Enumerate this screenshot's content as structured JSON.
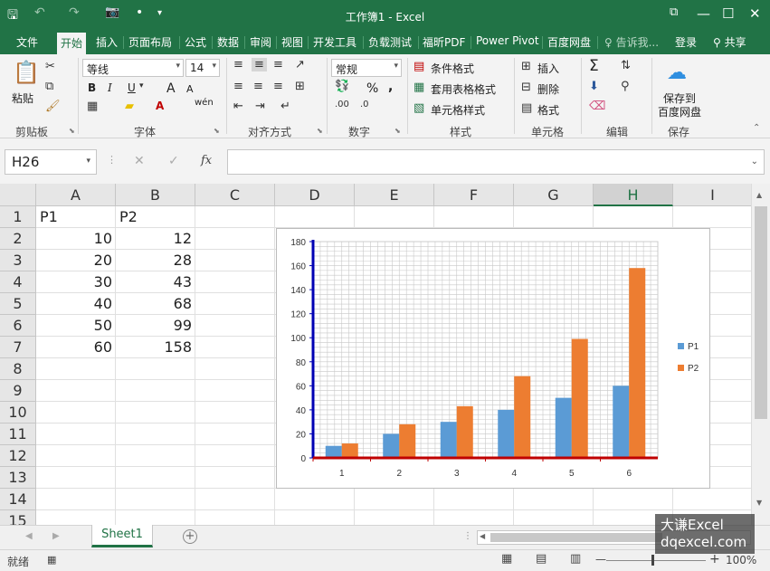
{
  "app": {
    "title": "工作簿1 - Excel",
    "qa_save_icon": "save-icon",
    "qa_undo": "↶",
    "qa_redo": "↷",
    "qa_camera": "📷",
    "qa_dot": "•",
    "qa_more": "▾",
    "win_restore": "⧉",
    "win_min": "—",
    "win_max": "☐",
    "win_close": "✕"
  },
  "tabs": {
    "file": "文件",
    "home": "开始",
    "insert": "插入",
    "layout": "页面布局",
    "formulas": "公式",
    "data": "数据",
    "review": "审阅",
    "view": "视图",
    "developer": "开发工具",
    "loadtest": "负载测试",
    "foxit": "福昕PDF",
    "powerpivot": "Power Pivot",
    "baidu": "百度网盘",
    "tellme": "♀ 告诉我...",
    "login": "登录",
    "share": "共享"
  },
  "ribbon": {
    "paste": "粘贴",
    "font_name": "等线",
    "font_size": "14",
    "bold": "B",
    "italic": "I",
    "underline": "U",
    "grow": "A",
    "shrink": "A",
    "wen": "wén",
    "number_format": "常规",
    "percent": "%",
    "comma": ",",
    "cond_format": "条件格式",
    "table_format": "套用表格格式",
    "cell_style": "单元格样式",
    "insert_cells": "插入",
    "delete_cells": "删除",
    "format_cells": "格式",
    "sigma": "Σ",
    "save_to": "保存到",
    "baidu_disk": "百度网盘",
    "groups": {
      "clipboard": "剪贴板",
      "font": "字体",
      "align": "对齐方式",
      "number": "数字",
      "styles": "样式",
      "cells": "单元格",
      "editing": "编辑",
      "save": "保存"
    }
  },
  "formula": {
    "namebox": "H26",
    "cancel": "✕",
    "enter": "✓",
    "fx": "fx",
    "value": ""
  },
  "columns": [
    "A",
    "B",
    "C",
    "D",
    "E",
    "F",
    "G",
    "H",
    "I"
  ],
  "rows": [
    "1",
    "2",
    "3",
    "4",
    "5",
    "6",
    "7",
    "8",
    "9",
    "10",
    "11",
    "12",
    "13",
    "14",
    "15"
  ],
  "cells": {
    "A1": "P1",
    "B1": "P2",
    "A": [
      "10",
      "20",
      "30",
      "40",
      "50",
      "60"
    ],
    "B": [
      "12",
      "28",
      "43",
      "68",
      "99",
      "158"
    ]
  },
  "chart_data": {
    "type": "bar",
    "categories": [
      "1",
      "2",
      "3",
      "4",
      "5",
      "6"
    ],
    "series": [
      {
        "name": "P1",
        "values": [
          10,
          20,
          30,
          40,
          50,
          60
        ],
        "color": "#5b9bd5"
      },
      {
        "name": "P2",
        "values": [
          12,
          28,
          43,
          68,
          99,
          158
        ],
        "color": "#ed7d31"
      }
    ],
    "ylim": [
      0,
      180
    ],
    "yticks": [
      0,
      20,
      40,
      60,
      80,
      100,
      120,
      140,
      160,
      180
    ],
    "grid": true,
    "legend": "right",
    "y_axis_color": "#0000b4",
    "x_axis_color": "#c00000"
  },
  "sheets": {
    "active": "Sheet1",
    "add": "+"
  },
  "status": {
    "ready": "就绪",
    "zoom": "100%",
    "minus": "—",
    "plus": "+"
  },
  "watermark": {
    "line1": "大谦Excel",
    "line2": "dqexcel.com"
  }
}
